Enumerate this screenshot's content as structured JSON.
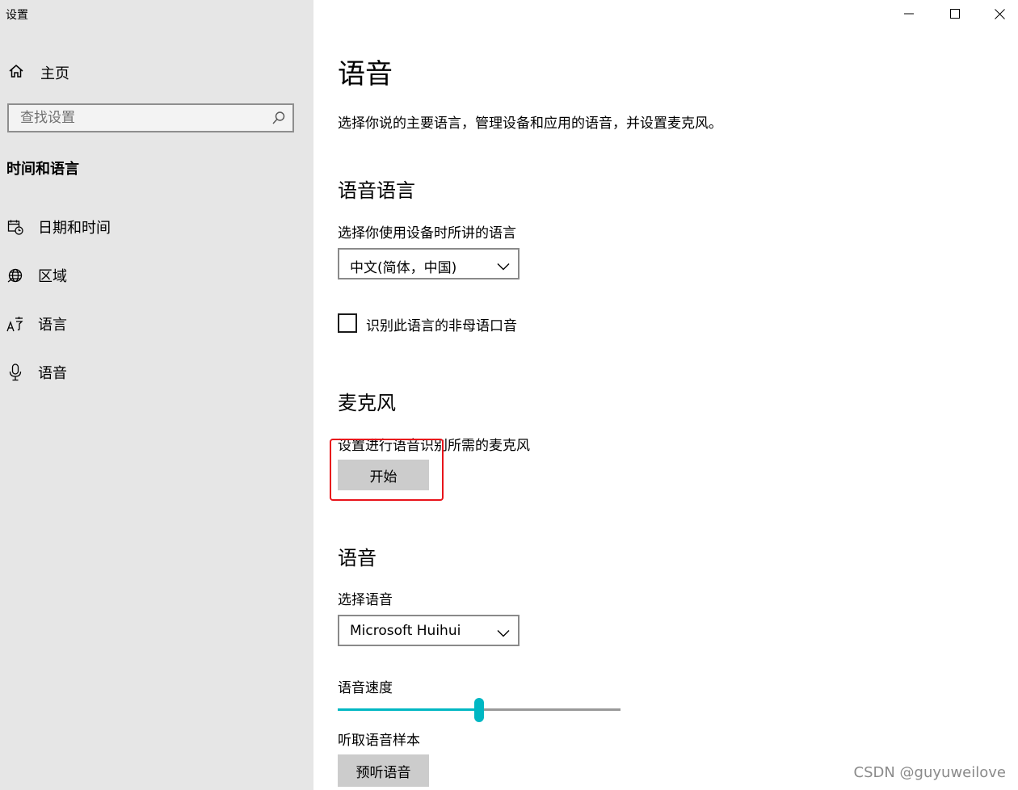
{
  "window": {
    "title": "设置",
    "controls": [
      "minimize",
      "maximize",
      "close"
    ]
  },
  "sidebar": {
    "home_label": "主页",
    "search_placeholder": "查找设置",
    "section_title": "时间和语言",
    "items": [
      {
        "label": "日期和时间",
        "icon": "date-time-icon"
      },
      {
        "label": "区域",
        "icon": "globe-icon"
      },
      {
        "label": "语言",
        "icon": "language-icon"
      },
      {
        "label": "语音",
        "icon": "microphone-icon"
      }
    ]
  },
  "main": {
    "title": "语音",
    "description": "选择你说的主要语言，管理设备和应用的语音，并设置麦克风。",
    "speech_language": {
      "heading": "语音语言",
      "label": "选择你使用设备时所讲的语言",
      "selected": "中文(简体，中国)",
      "checkbox_label": "识别此语言的非母语口音",
      "checkbox_checked": false
    },
    "microphone": {
      "heading": "麦克风",
      "label": "设置进行语音识别所需的麦克风",
      "button_label": "开始"
    },
    "voice": {
      "heading": "语音",
      "select_label": "选择语音",
      "selected": "Microsoft Huihui",
      "speed_label": "语音速度",
      "speed_value_fraction": 0.5,
      "sample_label": "听取语音样本",
      "sample_button": "预听语音"
    }
  },
  "watermark": "CSDN @guyuweilove",
  "colors": {
    "sidebar_bg": "#e6e6e6",
    "accent": "#00b7c3",
    "highlight_box": "#e8141b",
    "button_bg": "#cccccc"
  }
}
